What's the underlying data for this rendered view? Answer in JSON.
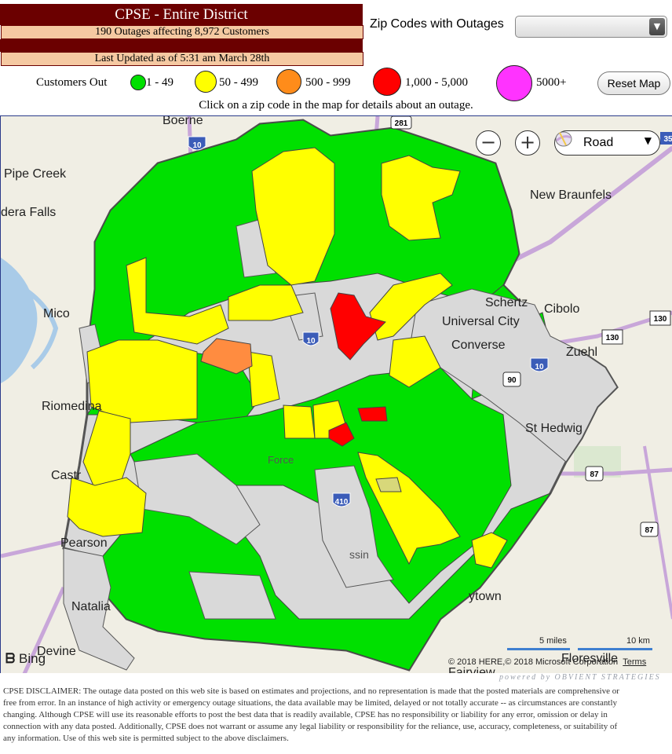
{
  "header": {
    "title": "CPSE - Entire District",
    "outages_summary": "190 Outages affecting 8,972 Customers",
    "last_updated": "Last Updated as of 5:31 am March 28th"
  },
  "zip_filter": {
    "label": "Zip Codes with Outages",
    "selected": ""
  },
  "legend": {
    "label": "Customers Out",
    "items": [
      {
        "label": "1 - 49",
        "color": "#00e000"
      },
      {
        "label": "50 - 499",
        "color": "#ffff00"
      },
      {
        "label": "500 - 999",
        "color": "#ff8c1a"
      },
      {
        "label": "1,000 - 5,000",
        "color": "#ff0000"
      },
      {
        "label": "5000+",
        "color": "#ff33ff"
      }
    ]
  },
  "reset_button": "Reset Map",
  "instruction": "Click on a zip code in the map for details about an outage.",
  "map": {
    "controls": {
      "zoom_out": "−",
      "zoom_in": "+",
      "map_type": "Road",
      "map_type_icon": "road-map-icon"
    },
    "towns": [
      "Boerne",
      "Pipe Creek",
      "dera Falls",
      "Mico",
      "Riomedina",
      "Castr",
      "Pearson",
      "Natalia",
      "Devine",
      "New Braunfels",
      "Schertz",
      "Cibolo",
      "Universal City",
      "Converse",
      "Zuehl",
      "St Hedwig",
      "Floresville",
      "ytown",
      "Fairview",
      "Force",
      "ssin"
    ],
    "highways": [
      "10",
      "281",
      "35",
      "130",
      "130",
      "410",
      "90",
      "87",
      "87",
      "10",
      "10"
    ],
    "bing": "Bing",
    "scale_miles": "5 miles",
    "scale_km": "10 km",
    "copyright": "© 2018 HERE,© 2018 Microsoft Corporation",
    "terms": "Terms"
  },
  "powered_by": "powered by OBVIENT STRATEGIES",
  "disclaimer": "CPSE DISCLAIMER:  The outage data posted on this web site is based on estimates and projections, and no representation is made that the posted materials are comprehensive or free from error.  In an instance of high activity or emergency outage situations, the data available may be limited, delayed or not totally accurate -- as circumstances are constantly changing.  Although CPSE will use its reasonable efforts to post the best data that is readily available, CPSE has no responsibility or liability for any error, omission or delay in connection with any data posted.  Additionally, CPSE does not warrant or assume any legal liability or responsibility for the reliance, use, accuracy, completeness, or suitability of any information.  Use of this web site is permitted subject to the above disclaimers."
}
